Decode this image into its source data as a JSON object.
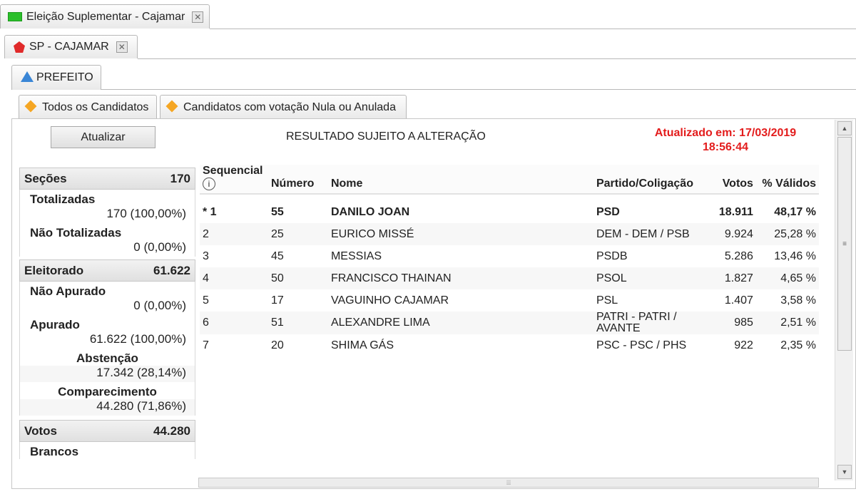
{
  "tabs": {
    "election": {
      "label": "Eleição Suplementar - Cajamar"
    },
    "city": {
      "label": "SP - CAJAMAR"
    },
    "office": {
      "label": "PREFEITO"
    },
    "all_candidates": {
      "label": "Todos os Candidatos"
    },
    "null_votes": {
      "label": "Candidatos com votação Nula ou Anulada"
    },
    "close_symbol": "✕"
  },
  "toolbar": {
    "refresh_label": "Atualizar",
    "notice": "RESULTADO SUJEITO A ALTERAÇÃO",
    "updated_line1": "Atualizado em: 17/03/2019",
    "updated_line2": "18:56:44"
  },
  "stats": {
    "secoes": {
      "label": "Seções",
      "value": "170"
    },
    "totalizadas": {
      "label": "Totalizadas",
      "value": "170 (100,00%)"
    },
    "nao_totalizadas": {
      "label": "Não Totalizadas",
      "value": "0 (0,00%)"
    },
    "eleitorado": {
      "label": "Eleitorado",
      "value": "61.622"
    },
    "nao_apurado": {
      "label": "Não Apurado",
      "value": "0 (0,00%)"
    },
    "apurado": {
      "label": "Apurado",
      "value": "61.622 (100,00%)"
    },
    "abstencao": {
      "label": "Abstenção",
      "value": "17.342 (28,14%)"
    },
    "comparecimento": {
      "label": "Comparecimento",
      "value": "44.280 (71,86%)"
    },
    "votos": {
      "label": "Votos",
      "value": "44.280"
    },
    "brancos": {
      "label": "Brancos"
    }
  },
  "table": {
    "headers": {
      "sequencial": "Sequencial",
      "info": "i",
      "numero": "Número",
      "nome": "Nome",
      "partido": "Partido/Coligação",
      "votos": "Votos",
      "validos": "% Válidos"
    },
    "rows": [
      {
        "seq": "* 1",
        "numero": "55",
        "nome": "DANILO JOAN",
        "partido": "PSD",
        "votos": "18.911",
        "validos": "48,17 %"
      },
      {
        "seq": "2",
        "numero": "25",
        "nome": "EURICO MISSÉ",
        "partido": "DEM - DEM / PSB",
        "votos": "9.924",
        "validos": "25,28 %"
      },
      {
        "seq": "3",
        "numero": "45",
        "nome": "MESSIAS",
        "partido": "PSDB",
        "votos": "5.286",
        "validos": "13,46 %"
      },
      {
        "seq": "4",
        "numero": "50",
        "nome": "FRANCISCO THAINAN",
        "partido": "PSOL",
        "votos": "1.827",
        "validos": "4,65 %"
      },
      {
        "seq": "5",
        "numero": "17",
        "nome": "VAGUINHO CAJAMAR",
        "partido": "PSL",
        "votos": "1.407",
        "validos": "3,58 %"
      },
      {
        "seq": "6",
        "numero": "51",
        "nome": "ALEXANDRE LIMA",
        "partido": "PATRI - PATRI / AVANTE",
        "votos": "985",
        "validos": "2,51 %"
      },
      {
        "seq": "7",
        "numero": "20",
        "nome": "SHIMA GÁS",
        "partido": "PSC - PSC / PHS",
        "votos": "922",
        "validos": "2,35 %"
      }
    ]
  },
  "scroll": {
    "up": "▲",
    "down": "▼",
    "grip": "≡",
    "hgrip": "⦙⦙⦙"
  },
  "colors": {
    "updated_red": "#e31c1c",
    "tab_green": "#2bbf2b",
    "tab_red": "#e02a2a",
    "tab_blue": "#3a86d6",
    "tab_orange": "#f5a623"
  }
}
